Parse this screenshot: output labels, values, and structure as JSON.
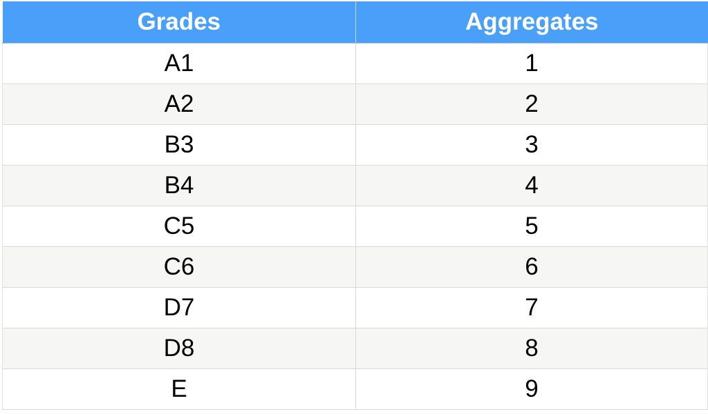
{
  "table": {
    "headers": [
      "Grades",
      "Aggregates"
    ],
    "rows": [
      [
        "A1",
        "1"
      ],
      [
        "A2",
        "2"
      ],
      [
        "B3",
        "3"
      ],
      [
        "B4",
        "4"
      ],
      [
        "C5",
        "5"
      ],
      [
        "C6",
        "6"
      ],
      [
        "D7",
        "7"
      ],
      [
        "D8",
        "8"
      ],
      [
        "E",
        "9"
      ]
    ]
  },
  "colors": {
    "header_background": "#4aa0f8",
    "header_text": "#ffffff",
    "row_alt_background": "#f6f6f5"
  }
}
